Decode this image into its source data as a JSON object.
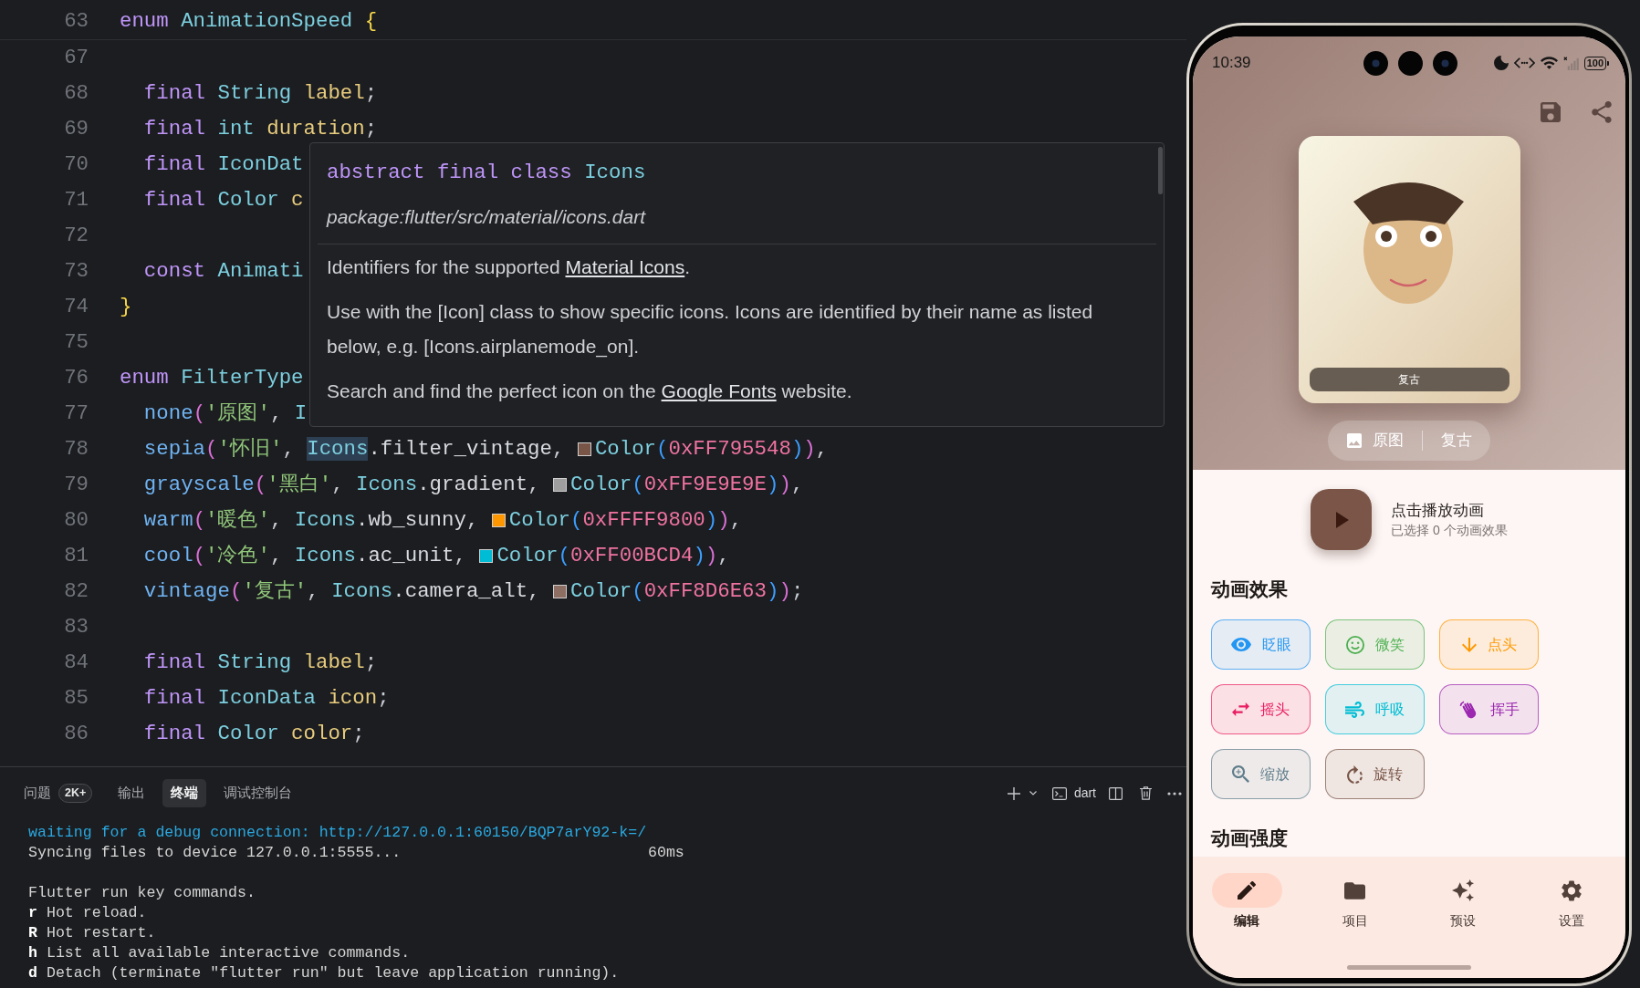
{
  "editor": {
    "sticky_line": {
      "number": "63",
      "tokens": [
        {
          "text": "enum",
          "kind": "keyword"
        },
        {
          "text": " AnimationSpeed",
          "kind": "type"
        },
        {
          "text": " {",
          "kind": "brace"
        }
      ]
    },
    "lines": [
      {
        "number": "67"
      },
      {
        "number": "68",
        "tokens": [
          {
            "text": "  final",
            "kind": "keyword"
          },
          {
            "text": " String",
            "kind": "type"
          },
          {
            "text": " label",
            "kind": "field"
          },
          {
            "text": ";",
            "kind": "punct"
          }
        ]
      },
      {
        "number": "69",
        "tokens": [
          {
            "text": "  final",
            "kind": "keyword"
          },
          {
            "text": " int",
            "kind": "type"
          },
          {
            "text": " duration",
            "kind": "field"
          },
          {
            "text": ";",
            "kind": "punct"
          }
        ]
      },
      {
        "number": "70",
        "tokens": [
          {
            "text": "  final",
            "kind": "keyword"
          },
          {
            "text": " IconDat",
            "kind": "type"
          }
        ]
      },
      {
        "number": "71",
        "tokens": [
          {
            "text": "  final",
            "kind": "keyword"
          },
          {
            "text": " Color",
            "kind": "type"
          },
          {
            "text": " c",
            "kind": "field"
          }
        ]
      },
      {
        "number": "72"
      },
      {
        "number": "73",
        "tokens": [
          {
            "text": "  const",
            "kind": "keyword"
          },
          {
            "text": " Animati",
            "kind": "type"
          }
        ]
      },
      {
        "number": "74",
        "tokens": [
          {
            "text": "}",
            "kind": "brace"
          }
        ]
      },
      {
        "number": "75"
      },
      {
        "number": "76",
        "tokens": [
          {
            "text": "enum",
            "kind": "keyword"
          },
          {
            "text": " FilterType",
            "kind": "type"
          }
        ]
      },
      {
        "number": "77",
        "tokens": [
          {
            "text": "  none",
            "kind": "enum-value"
          },
          {
            "text": "(",
            "kind": "paren"
          },
          {
            "text": "'原图'",
            "kind": "string"
          },
          {
            "text": ", ",
            "kind": "punct"
          },
          {
            "text": "I",
            "kind": "type"
          }
        ]
      },
      {
        "number": "78",
        "tokens": [
          {
            "text": "  sepia",
            "kind": "enum-value"
          },
          {
            "text": "(",
            "kind": "paren"
          },
          {
            "text": "'怀旧'",
            "kind": "string"
          },
          {
            "text": ", ",
            "kind": "punct"
          },
          {
            "text": "Icons",
            "kind": "type-match"
          },
          {
            "text": ".filter_vintage",
            "kind": "member"
          },
          {
            "text": ", ",
            "kind": "punct"
          },
          {
            "kind": "swatch",
            "color": "#795548"
          },
          {
            "text": "Color",
            "kind": "type"
          },
          {
            "text": "(",
            "kind": "paren2"
          },
          {
            "text": "0xFF795548",
            "kind": "number"
          },
          {
            "text": ")",
            "kind": "paren2"
          },
          {
            "text": ")",
            "kind": "paren"
          },
          {
            "text": ",",
            "kind": "punct"
          }
        ]
      },
      {
        "number": "79",
        "tokens": [
          {
            "text": "  grayscale",
            "kind": "enum-value"
          },
          {
            "text": "(",
            "kind": "paren"
          },
          {
            "text": "'黑白'",
            "kind": "string"
          },
          {
            "text": ", ",
            "kind": "punct"
          },
          {
            "text": "Icons",
            "kind": "type"
          },
          {
            "text": ".gradient",
            "kind": "member"
          },
          {
            "text": ", ",
            "kind": "punct"
          },
          {
            "kind": "swatch",
            "color": "#9e9e9e"
          },
          {
            "text": "Color",
            "kind": "type"
          },
          {
            "text": "(",
            "kind": "paren2"
          },
          {
            "text": "0xFF9E9E9E",
            "kind": "number"
          },
          {
            "text": ")",
            "kind": "paren2"
          },
          {
            "text": ")",
            "kind": "paren"
          },
          {
            "text": ",",
            "kind": "punct"
          }
        ]
      },
      {
        "number": "80",
        "tokens": [
          {
            "text": "  warm",
            "kind": "enum-value"
          },
          {
            "text": "(",
            "kind": "paren"
          },
          {
            "text": "'暖色'",
            "kind": "string"
          },
          {
            "text": ", ",
            "kind": "punct"
          },
          {
            "text": "Icons",
            "kind": "type"
          },
          {
            "text": ".wb_sunny",
            "kind": "member"
          },
          {
            "text": ", ",
            "kind": "punct"
          },
          {
            "kind": "swatch",
            "color": "#ff9800"
          },
          {
            "text": "Color",
            "kind": "type"
          },
          {
            "text": "(",
            "kind": "paren2"
          },
          {
            "text": "0xFFFF9800",
            "kind": "number"
          },
          {
            "text": ")",
            "kind": "paren2"
          },
          {
            "text": ")",
            "kind": "paren"
          },
          {
            "text": ",",
            "kind": "punct"
          }
        ]
      },
      {
        "number": "81",
        "tokens": [
          {
            "text": "  cool",
            "kind": "enum-value"
          },
          {
            "text": "(",
            "kind": "paren"
          },
          {
            "text": "'冷色'",
            "kind": "string"
          },
          {
            "text": ", ",
            "kind": "punct"
          },
          {
            "text": "Icons",
            "kind": "type"
          },
          {
            "text": ".ac_unit",
            "kind": "member"
          },
          {
            "text": ", ",
            "kind": "punct"
          },
          {
            "kind": "swatch",
            "color": "#00bcd4"
          },
          {
            "text": "Color",
            "kind": "type"
          },
          {
            "text": "(",
            "kind": "paren2"
          },
          {
            "text": "0xFF00BCD4",
            "kind": "number"
          },
          {
            "text": ")",
            "kind": "paren2"
          },
          {
            "text": ")",
            "kind": "paren"
          },
          {
            "text": ",",
            "kind": "punct"
          }
        ]
      },
      {
        "number": "82",
        "tokens": [
          {
            "text": "  vintage",
            "kind": "enum-value"
          },
          {
            "text": "(",
            "kind": "paren"
          },
          {
            "text": "'复古'",
            "kind": "string"
          },
          {
            "text": ", ",
            "kind": "punct"
          },
          {
            "text": "Icons",
            "kind": "type"
          },
          {
            "text": ".camera_alt",
            "kind": "member"
          },
          {
            "text": ", ",
            "kind": "punct"
          },
          {
            "kind": "swatch",
            "color": "#8d6e63"
          },
          {
            "text": "Color",
            "kind": "type"
          },
          {
            "text": "(",
            "kind": "paren2"
          },
          {
            "text": "0xFF8D6E63",
            "kind": "number"
          },
          {
            "text": ")",
            "kind": "paren2"
          },
          {
            "text": ")",
            "kind": "paren"
          },
          {
            "text": ";",
            "kind": "punct"
          }
        ]
      },
      {
        "number": "83"
      },
      {
        "number": "84",
        "tokens": [
          {
            "text": "  final",
            "kind": "keyword"
          },
          {
            "text": " String",
            "kind": "type"
          },
          {
            "text": " label",
            "kind": "field"
          },
          {
            "text": ";",
            "kind": "punct"
          }
        ]
      },
      {
        "number": "85",
        "tokens": [
          {
            "text": "  final",
            "kind": "keyword"
          },
          {
            "text": " IconData",
            "kind": "type"
          },
          {
            "text": " icon",
            "kind": "field"
          },
          {
            "text": ";",
            "kind": "punct"
          }
        ]
      },
      {
        "number": "86",
        "tokens": [
          {
            "text": "  final",
            "kind": "keyword"
          },
          {
            "text": " Color",
            "kind": "type"
          },
          {
            "text": " color",
            "kind": "field"
          },
          {
            "text": ";",
            "kind": "punct"
          }
        ]
      }
    ]
  },
  "hover": {
    "signature": [
      {
        "text": "abstract",
        "kind": "keyword"
      },
      {
        "text": " final",
        "kind": "keyword"
      },
      {
        "text": " class",
        "kind": "keyword"
      },
      {
        "text": " Icons",
        "kind": "type"
      }
    ],
    "source": "package:flutter/src/material/icons.dart",
    "paragraphs": [
      [
        {
          "text": "Identifiers for the supported ",
          "kind": "text"
        },
        {
          "text": "Material Icons",
          "kind": "link"
        },
        {
          "text": ".",
          "kind": "text"
        }
      ],
      [
        {
          "text": "Use with the [Icon] class to show specific icons. Icons are identified by their name as listed below, e.g. [Icons.airplanemode_on].",
          "kind": "text"
        }
      ],
      [
        {
          "text": "Search and find the perfect icon on the ",
          "kind": "text"
        },
        {
          "text": "Google Fonts",
          "kind": "link"
        },
        {
          "text": " website.",
          "kind": "text"
        }
      ]
    ]
  },
  "panel": {
    "tabs": [
      {
        "label": "问题",
        "badge": "2K+",
        "selected": false
      },
      {
        "label": "输出",
        "selected": false
      },
      {
        "label": "终端",
        "selected": true
      },
      {
        "label": "调试控制台",
        "selected": false
      }
    ],
    "shell": "dart",
    "terminal": [
      {
        "text": "waiting for a debug connection: http://127.0.0.1:60150/BQP7arY92-k=/",
        "kind": "info"
      },
      {
        "text": "Syncing files to device 127.0.0.1:5555...",
        "trailing": "60ms",
        "kind": "plain"
      },
      {
        "kind": "blank"
      },
      {
        "text": "Flutter run key commands.",
        "kind": "plain"
      },
      {
        "text": "**r** Hot reload.",
        "kind": "plain"
      },
      {
        "text": "**R** Hot restart.",
        "kind": "plain"
      },
      {
        "text": "**h** List all available interactive commands.",
        "kind": "plain"
      },
      {
        "text": "**d** Detach (terminate \"flutter run\" but leave application running).",
        "kind": "plain"
      }
    ]
  },
  "phone": {
    "status_bar": {
      "time": "10:39",
      "battery": "100"
    },
    "preview": {
      "filter_label": "复古"
    },
    "compare": {
      "original": "原图",
      "filtered": "复古"
    },
    "player": {
      "title": "点击播放动画",
      "subtitle": "已选择 0 个动画效果"
    },
    "effects": {
      "heading": "动画效果",
      "chips": [
        {
          "label": "眨眼",
          "color": "#2196f3",
          "selected": false
        },
        {
          "label": "微笑",
          "color": "#4caf50",
          "selected": false
        },
        {
          "label": "点头",
          "color": "#ff9800",
          "selected": false
        },
        {
          "label": "摇头",
          "color": "#e91e63",
          "selected": false
        },
        {
          "label": "呼吸",
          "color": "#00bcd4",
          "selected": false
        },
        {
          "label": "挥手",
          "color": "#9c27b0",
          "selected": false
        },
        {
          "label": "缩放",
          "color": "#607d8b",
          "selected": false
        },
        {
          "label": "旋转",
          "color": "#795548",
          "selected": false
        }
      ]
    },
    "intensity": {
      "heading": "动画强度"
    },
    "nav": [
      {
        "label": "编辑",
        "selected": true
      },
      {
        "label": "项目",
        "selected": false
      },
      {
        "label": "预设",
        "selected": false
      },
      {
        "label": "设置",
        "selected": false
      }
    ]
  }
}
